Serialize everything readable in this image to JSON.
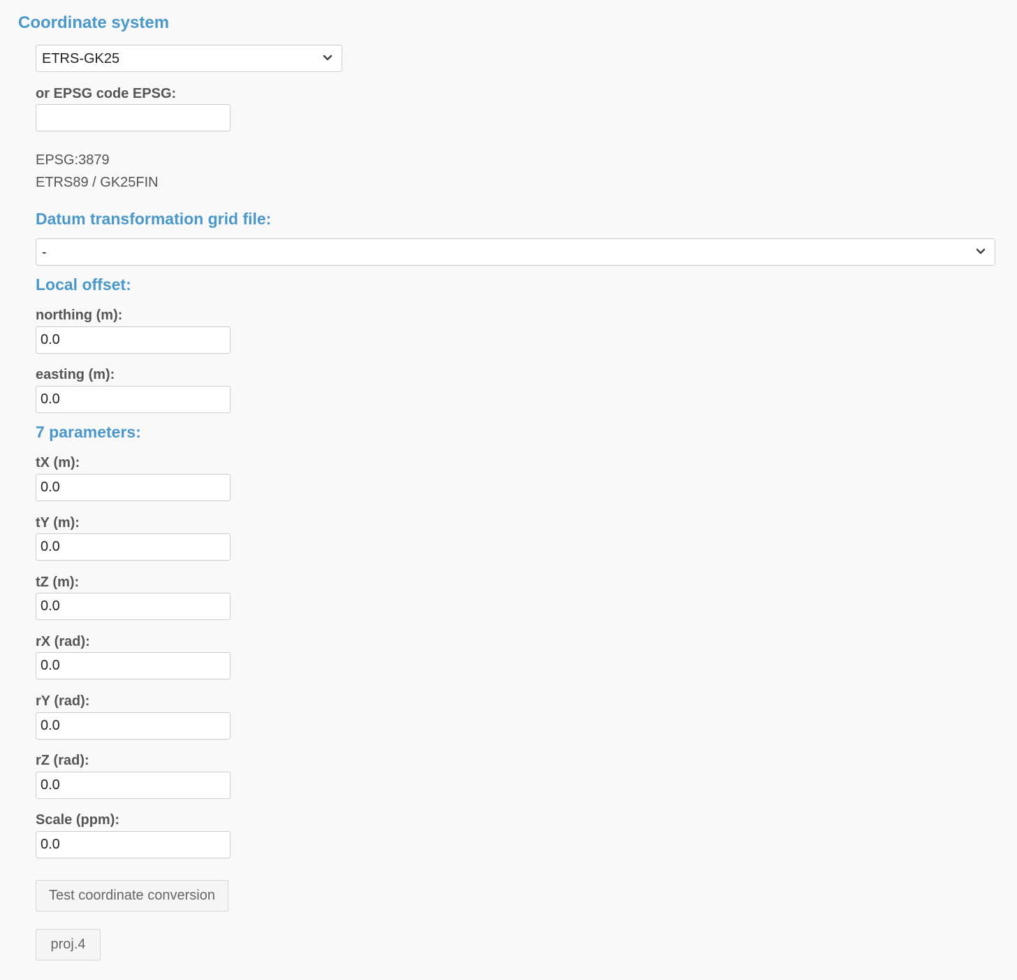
{
  "coordinate_system": {
    "heading": "Coordinate system",
    "selected": "ETRS-GK25",
    "epsg_label": "or EPSG code EPSG:",
    "epsg_value": "",
    "info_code": "EPSG:3879",
    "info_name": "ETRS89 / GK25FIN"
  },
  "datum": {
    "heading": "Datum transformation grid file:",
    "selected": "-"
  },
  "local_offset": {
    "heading": "Local offset:",
    "northing_label": "northing (m):",
    "northing_value": "0.0",
    "easting_label": "easting (m):",
    "easting_value": "0.0"
  },
  "seven_params": {
    "heading": "7 parameters:",
    "tx_label": "tX (m):",
    "tx_value": "0.0",
    "ty_label": "tY (m):",
    "ty_value": "0.0",
    "tz_label": "tZ (m):",
    "tz_value": "0.0",
    "rx_label": "rX (rad):",
    "rx_value": "0.0",
    "ry_label": "rY (rad):",
    "ry_value": "0.0",
    "rz_label": "rZ (rad):",
    "rz_value": "0.0",
    "scale_label": "Scale (ppm):",
    "scale_value": "0.0"
  },
  "buttons": {
    "test_label": "Test coordinate conversion",
    "proj4_label": "proj.4"
  },
  "icons": {
    "dropdown": "chevron-down-icon"
  },
  "colors": {
    "heading": "#4a98c9",
    "text": "#555555",
    "background": "#f9f9f9"
  }
}
